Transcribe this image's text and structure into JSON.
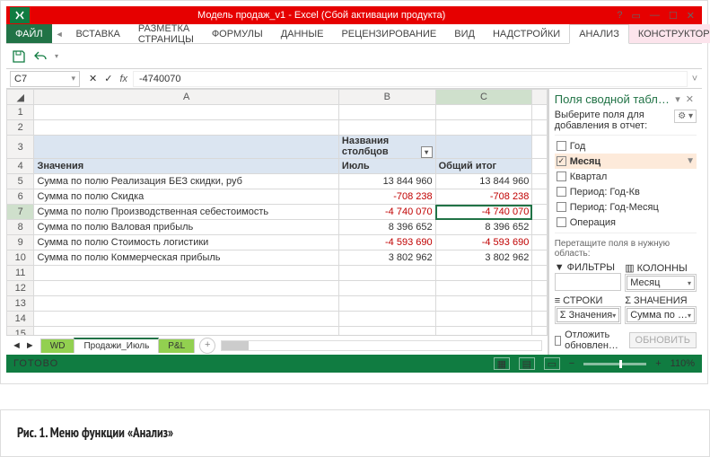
{
  "titlebar": {
    "title": "Модель продаж_v1  -  Excel (Сбой активации продукта)"
  },
  "ribbon": {
    "file": "ФАЙЛ",
    "tabs": [
      "ВСТАВКА",
      "РАЗМЕТКА СТРАНИЦЫ",
      "ФОРМУЛЫ",
      "ДАННЫЕ",
      "РЕЦЕНЗИРОВАНИЕ",
      "ВИД",
      "НАДСТРОЙКИ"
    ],
    "context": [
      "АНАЛИЗ",
      "КОНСТРУКТОР"
    ]
  },
  "formula": {
    "name_box": "C7",
    "value": "-4740070"
  },
  "columns": [
    "A",
    "B",
    "C"
  ],
  "pivot": {
    "col_header_label": "Названия столбцов",
    "row_header_label": "Значения",
    "col_month": "Июль",
    "grand_total": "Общий итог",
    "rows": [
      {
        "n": 5,
        "label": "Сумма по полю Реализация БЕЗ скидки, руб",
        "b": "13 844 960",
        "c": "13 844 960",
        "neg": false
      },
      {
        "n": 6,
        "label": "Сумма по полю Скидка",
        "b": "-708 238",
        "c": "-708 238",
        "neg": true
      },
      {
        "n": 7,
        "label": "Сумма по полю Производственная себестоимость",
        "b": "-4 740 070",
        "c": "-4 740 070",
        "neg": true,
        "active": true
      },
      {
        "n": 8,
        "label": "Сумма по полю Валовая прибыль",
        "b": "8 396 652",
        "c": "8 396 652",
        "neg": false
      },
      {
        "n": 9,
        "label": "Сумма по полю Стоимость логистики",
        "b": "-4 593 690",
        "c": "-4 593 690",
        "neg": true
      },
      {
        "n": 10,
        "label": "Сумма по полю Коммерческая прибыль",
        "b": "3 802 962",
        "c": "3 802 962",
        "neg": false
      }
    ]
  },
  "sheets": {
    "wd": "WD",
    "active": "Продажи_Июль",
    "pl": "P&L"
  },
  "pane": {
    "title": "Поля сводной табл…",
    "sub": "Выберите поля для добавления в отчет:",
    "fields": [
      {
        "label": "Год",
        "checked": false
      },
      {
        "label": "Месяц",
        "checked": true,
        "selected": true,
        "filter": true
      },
      {
        "label": "Квартал",
        "checked": false
      },
      {
        "label": "Период: Год-Кв",
        "checked": false
      },
      {
        "label": "Период: Год-Месяц",
        "checked": false
      },
      {
        "label": "Операция",
        "checked": false
      }
    ],
    "drag_label": "Перетащите поля в нужную область:",
    "zones": {
      "filters": "ФИЛЬТРЫ",
      "columns": "КОЛОННЫ",
      "rows": "СТРОКИ",
      "values": "ЗНАЧЕНИЯ",
      "col_chip": "Месяц",
      "row_chip": "Σ Значения",
      "val_chip": "Сумма по …"
    },
    "defer": "Отложить обновлен…",
    "update": "ОБНОВИТЬ"
  },
  "status": {
    "ready": "ГОТОВО",
    "zoom": "110%"
  },
  "caption": "Рис. 1. Меню функции «Анализ»"
}
